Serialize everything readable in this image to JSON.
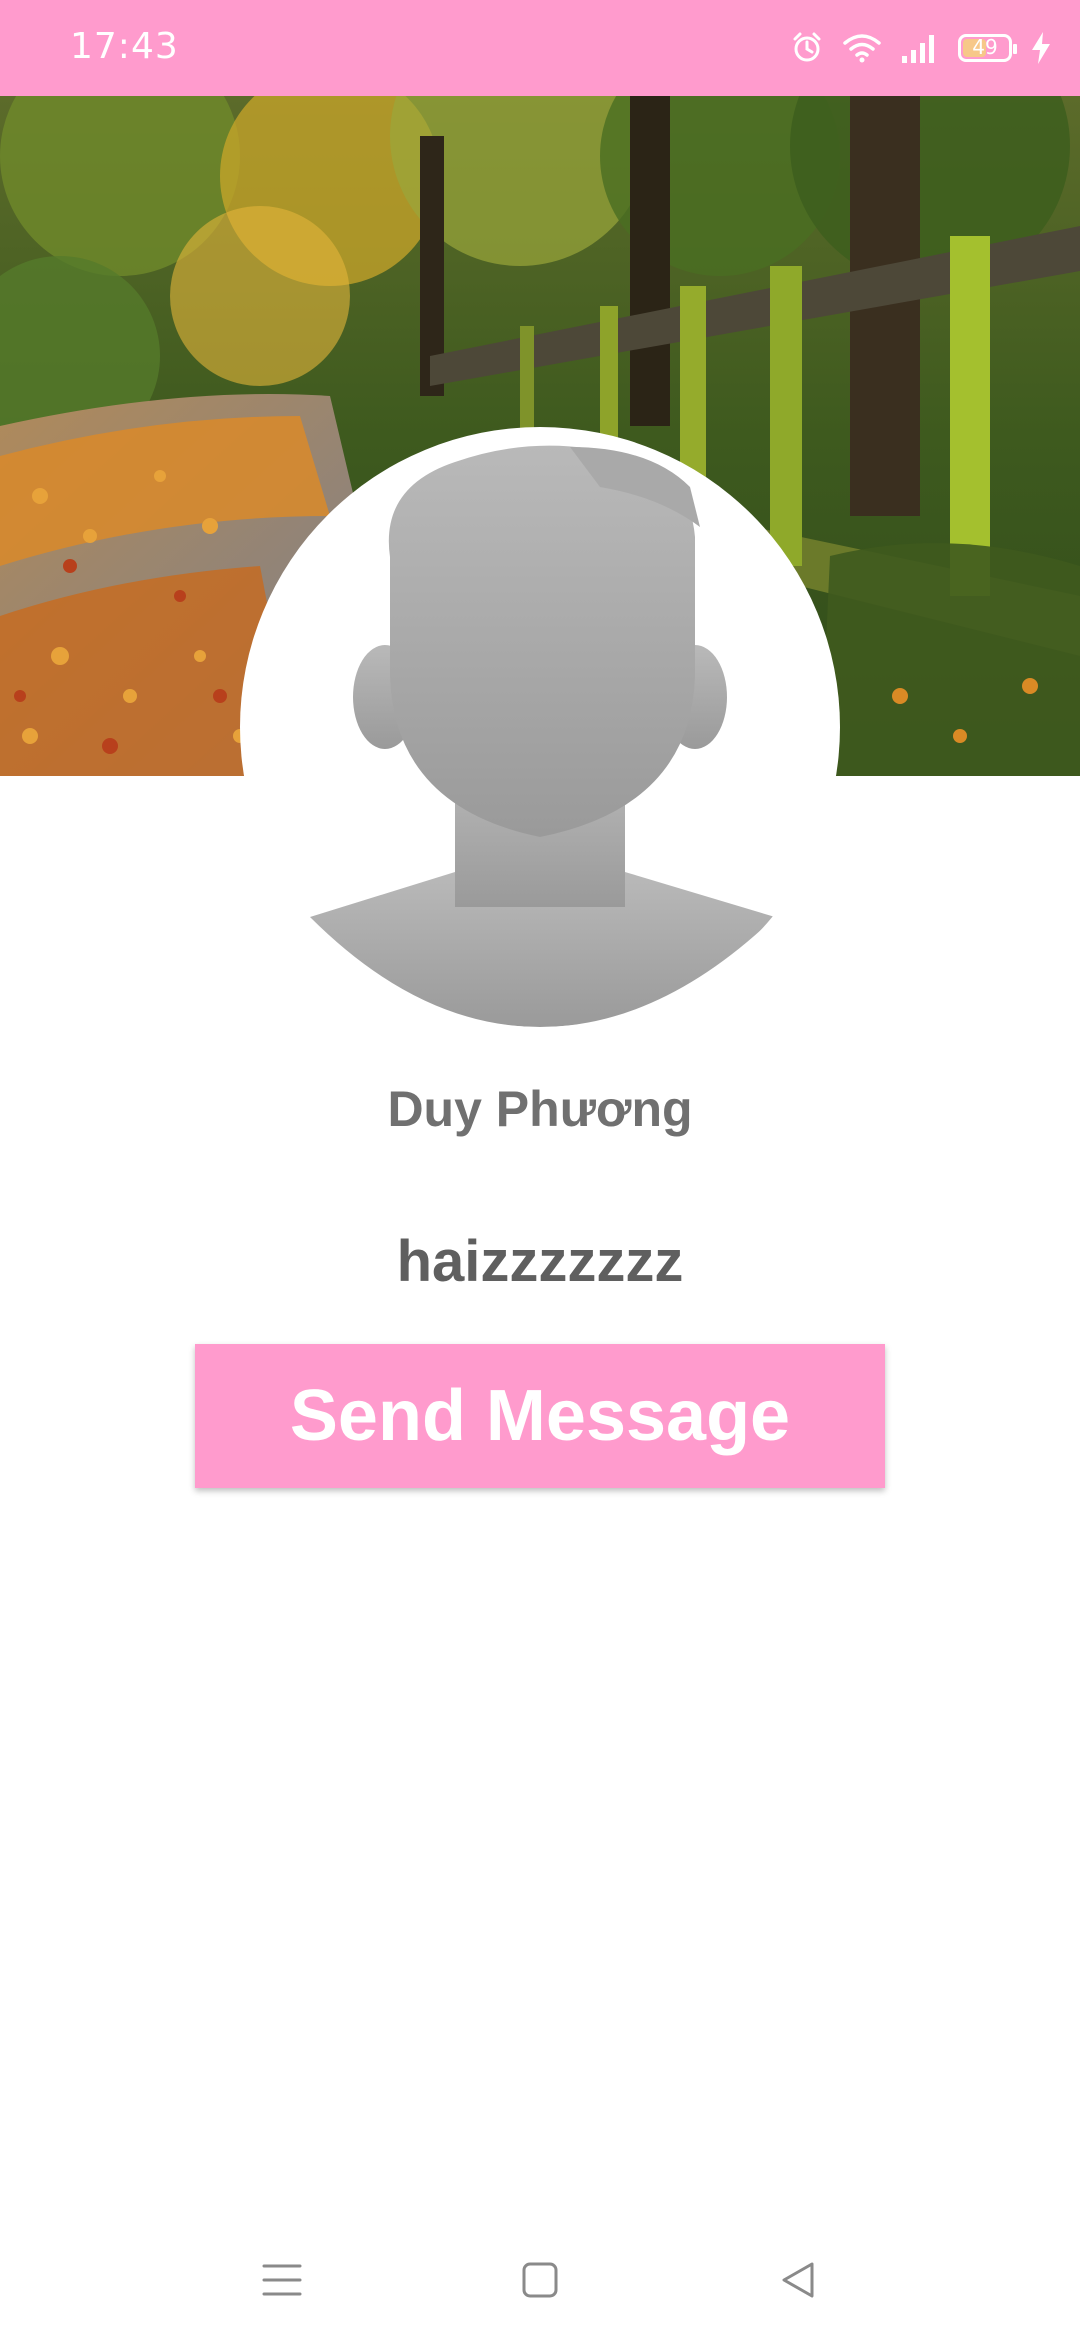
{
  "status_bar": {
    "time": "17:43",
    "battery_level": "49",
    "background_color": "#ff9bcd",
    "icons": [
      "alarm-icon",
      "wifi-icon",
      "signal-icon",
      "battery-icon",
      "charging-icon"
    ]
  },
  "profile": {
    "name": "Duy Phương",
    "status": "haizzzzzzz"
  },
  "actions": {
    "send_message_label": "Send Message",
    "button_color": "#ff9bcd"
  },
  "nav_bar": {
    "icons": [
      "menu-icon",
      "home-icon",
      "back-icon"
    ]
  }
}
